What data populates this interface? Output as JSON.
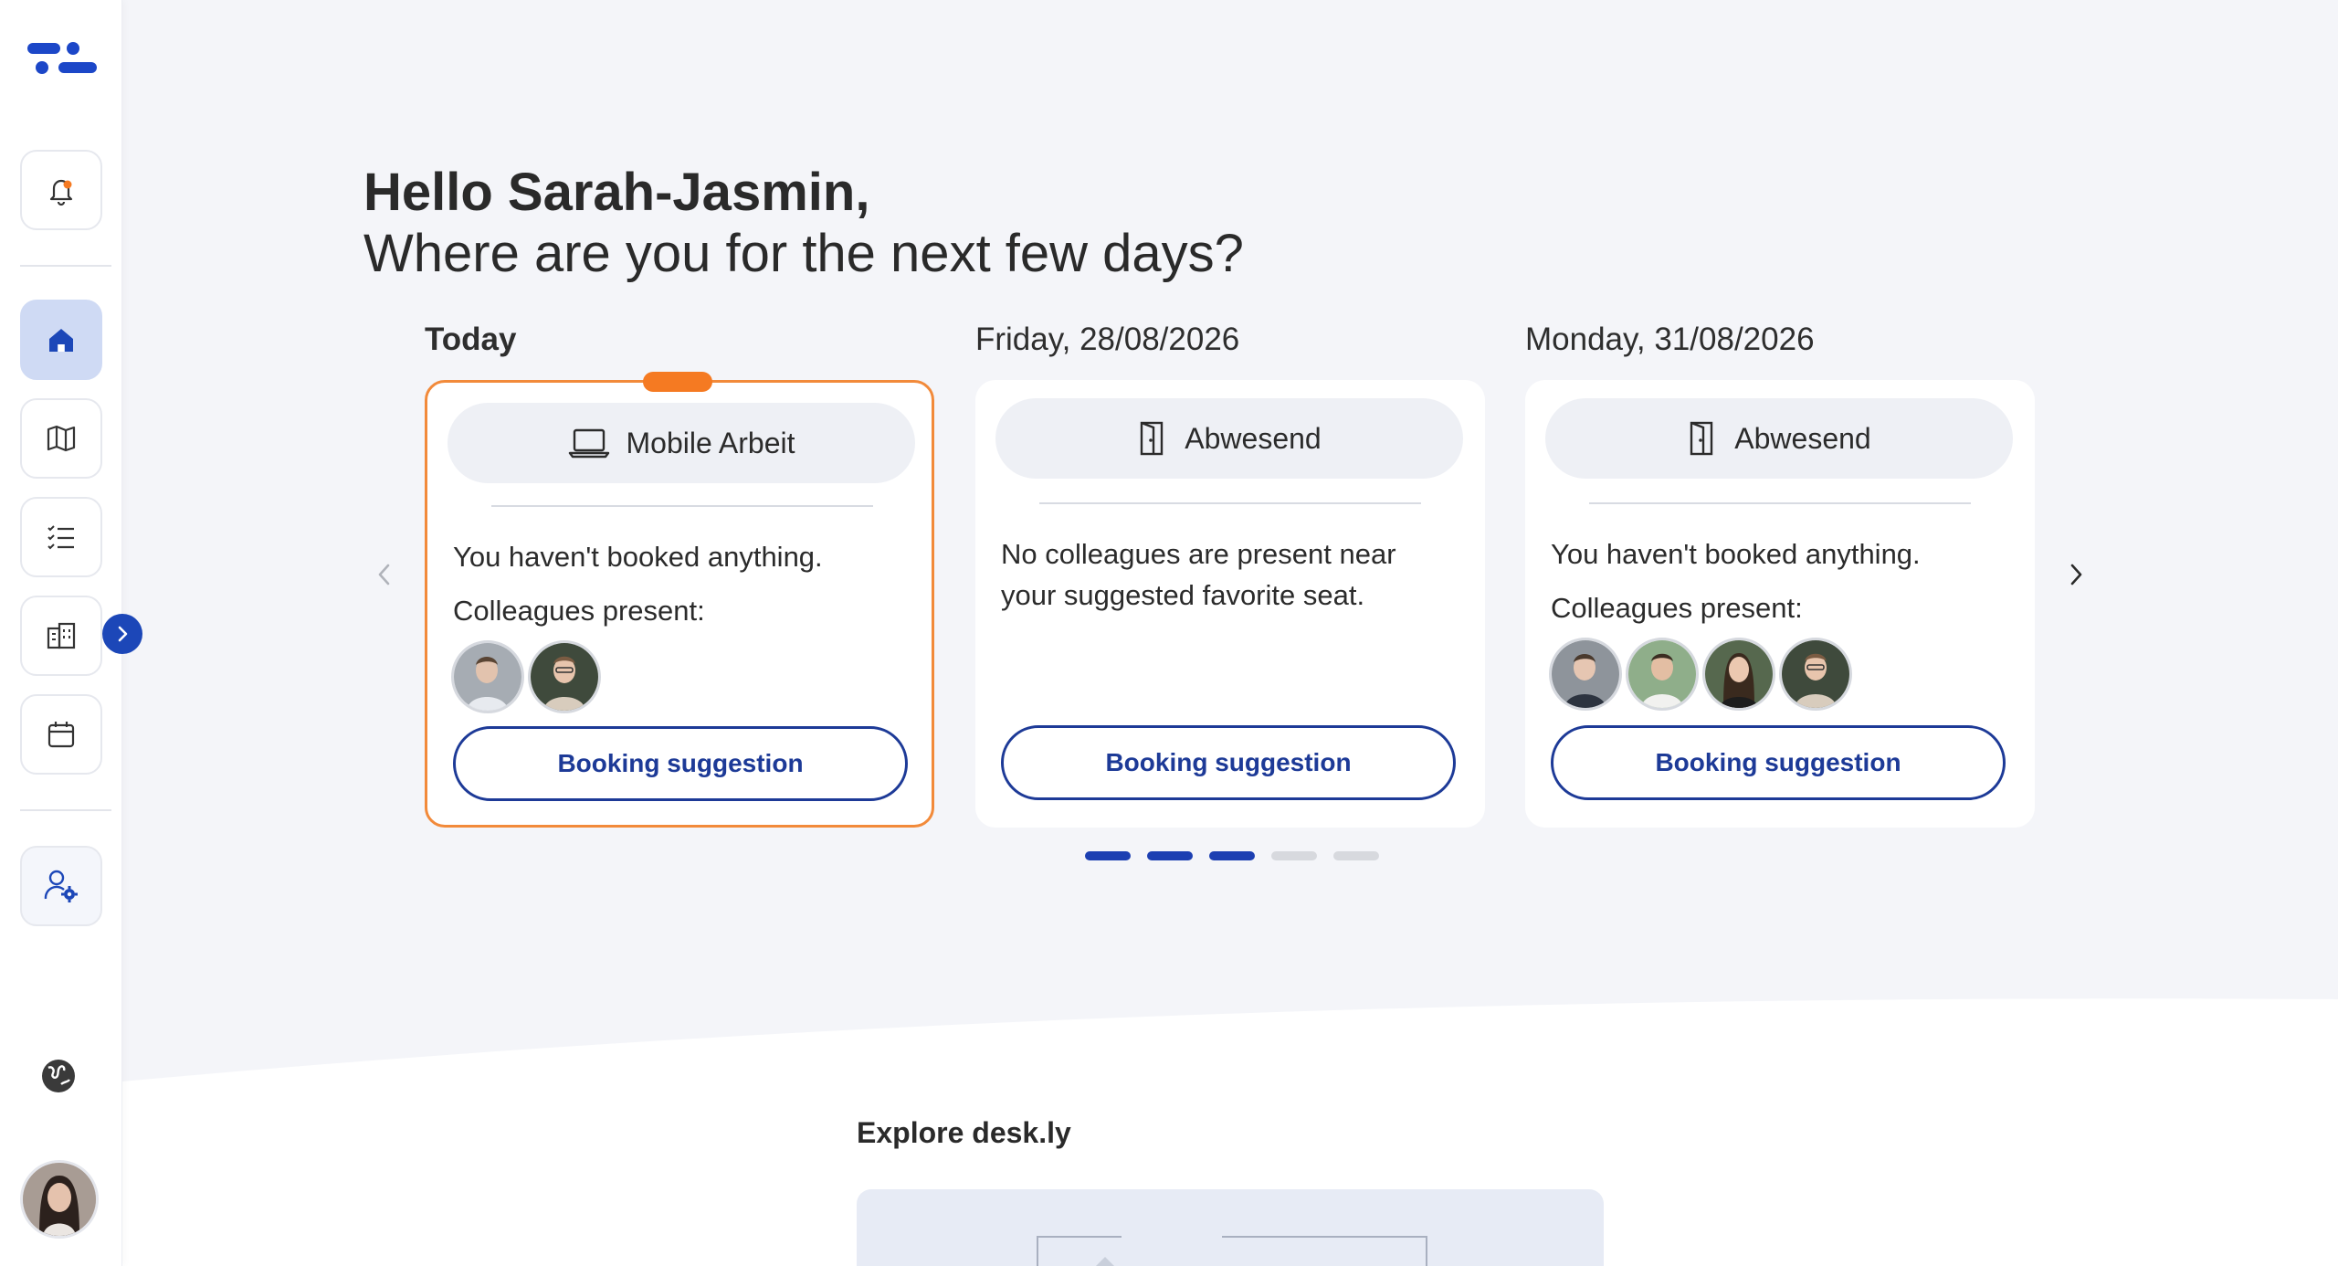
{
  "greeting": {
    "hello": "Hello Sarah-Jasmin,",
    "question": "Where are you for the next few days?"
  },
  "days": [
    {
      "label": "Today",
      "status": "Mobile Arbeit",
      "status_icon": "laptop-icon",
      "line1": "You haven't booked anything.",
      "line2": "Colleagues present:",
      "colleague_count": 2,
      "button": "Booking suggestion",
      "selected": true
    },
    {
      "label": "Friday, 28/08/2026",
      "status": "Abwesend",
      "status_icon": "door-icon",
      "line1": "No colleagues are present near your suggested favorite seat.",
      "button": "Booking suggestion",
      "selected": false
    },
    {
      "label": "Monday, 31/08/2026",
      "status": "Abwesend",
      "status_icon": "door-icon",
      "line1": "You haven't booked anything.",
      "line2": "Colleagues present:",
      "colleague_count": 4,
      "button": "Booking suggestion",
      "selected": false
    }
  ],
  "pagination": {
    "total": 5,
    "active_count": 3
  },
  "explore": {
    "title": "Explore desk.ly"
  },
  "sidebar": {
    "items": [
      "notifications-icon",
      "home-icon",
      "map-icon",
      "list-icon",
      "building-icon",
      "calendar-icon",
      "user-settings-icon",
      "globe-icon"
    ]
  },
  "colors": {
    "accent": "#1c3fb2",
    "selected_border": "#f28a3a",
    "indicator": "#f57a22",
    "active_nav": "#cfdaf4"
  }
}
